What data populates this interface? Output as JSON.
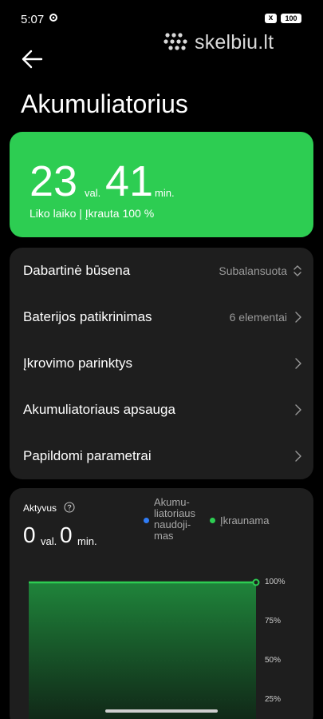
{
  "status_bar": {
    "time": "5:07",
    "x_badge": "x",
    "battery_level": "100"
  },
  "watermark": {
    "text": "skelbiu.lt"
  },
  "header": {
    "title": "Akumuliatorius"
  },
  "summary": {
    "hours": "23",
    "hours_unit": "val.",
    "minutes": "41",
    "minutes_unit": "min.",
    "subtitle": "Liko laiko | Įkrauta 100 %",
    "accent_color": "#2dcd52"
  },
  "settings": [
    {
      "label": "Dabartinė būsena",
      "value": "Subalansuota",
      "icon": "up-down-chevron-icon"
    },
    {
      "label": "Baterijos patikrinimas",
      "value": "6 elementai",
      "icon": "chevron-right-icon"
    },
    {
      "label": "Įkrovimo parinktys",
      "value": "",
      "icon": "chevron-right-icon"
    },
    {
      "label": "Akumuliatoriaus apsauga",
      "value": "",
      "icon": "chevron-right-icon"
    },
    {
      "label": "Papildomi parametrai",
      "value": "",
      "icon": "chevron-right-icon"
    }
  ],
  "usage": {
    "title": "Aktyvus",
    "hours": "0",
    "hours_unit": "val.",
    "minutes": "0",
    "minutes_unit": "min.",
    "legend": [
      {
        "lines": [
          "Akumu-",
          "liatoriaus",
          "naudoji-",
          "mas"
        ],
        "color": "#2f7cf6"
      },
      {
        "lines": [
          "Įkraunama"
        ],
        "color": "#2dcd52"
      }
    ]
  },
  "chart_data": {
    "type": "area",
    "title": "",
    "xlabel": "",
    "ylabel": "",
    "yticks": [
      "100%",
      "75%",
      "50%",
      "25%"
    ],
    "ylim": [
      0,
      100
    ],
    "series": [
      {
        "values": [
          100,
          100
        ]
      }
    ],
    "line_color": "#2dcd52",
    "grid": true
  }
}
